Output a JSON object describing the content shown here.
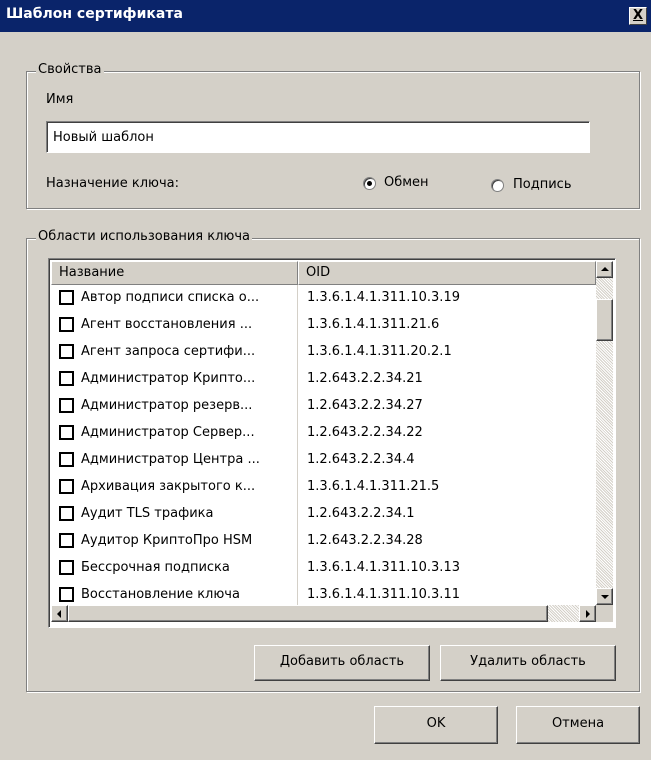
{
  "window": {
    "title": "Шаблон сертификата",
    "close_label": "X"
  },
  "properties": {
    "legend": "Свойства",
    "name_label": "Имя",
    "name_value": "Новый шаблон",
    "key_purpose_label": "Назначение ключа:",
    "radio_exchange": "Обмен",
    "radio_signature": "Подпись",
    "selected": "Обмен"
  },
  "usage": {
    "legend": "Области использования ключа",
    "columns": {
      "name": "Название",
      "oid": "OID"
    },
    "rows": [
      {
        "name": "Автор подписи списка о...",
        "oid": "1.3.6.1.4.1.311.10.3.19"
      },
      {
        "name": "Агент восстановления ...",
        "oid": "1.3.6.1.4.1.311.21.6"
      },
      {
        "name": "Агент запроса сертифи...",
        "oid": "1.3.6.1.4.1.311.20.2.1"
      },
      {
        "name": "Администратор Крипто...",
        "oid": "1.2.643.2.2.34.21"
      },
      {
        "name": "Администратор резерв...",
        "oid": "1.2.643.2.2.34.27"
      },
      {
        "name": "Администратор Сервер...",
        "oid": "1.2.643.2.2.34.22"
      },
      {
        "name": "Администратор Центра ...",
        "oid": "1.2.643.2.2.34.4"
      },
      {
        "name": "Архивация закрытого к...",
        "oid": "1.3.6.1.4.1.311.21.5"
      },
      {
        "name": "Аудит TLS трафика",
        "oid": "1.2.643.2.2.34.1"
      },
      {
        "name": "Аудитор КриптоПро HSM",
        "oid": "1.2.643.2.2.34.28"
      },
      {
        "name": "Бессрочная подписка",
        "oid": "1.3.6.1.4.1.311.10.3.13"
      },
      {
        "name": "Восстановление ключа",
        "oid": "1.3.6.1.4.1.311.10.3.11"
      }
    ],
    "add_button": "Добавить область",
    "remove_button": "Удалить область"
  },
  "footer": {
    "ok": "OK",
    "cancel": "Отмена"
  },
  "colors": {
    "titlebar": "#0a246a",
    "face": "#d4d0c8"
  }
}
